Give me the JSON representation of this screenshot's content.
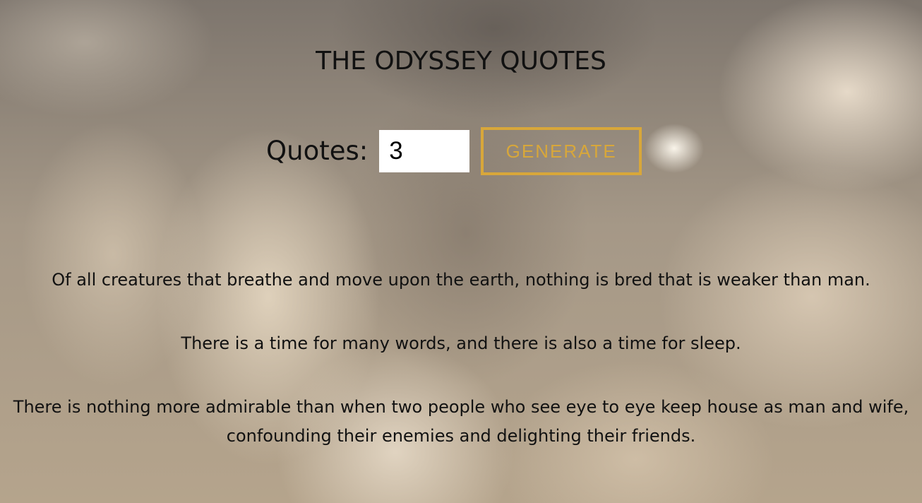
{
  "page": {
    "title": "THE ODYSSEY QUOTES"
  },
  "controls": {
    "quotes_label": "Quotes:",
    "quote_count": "3",
    "generate_label": "GENERATE",
    "accent_color": "#d8a73a"
  },
  "quotes": [
    {
      "text": "Of all creatures that breathe and move upon the earth, nothing is bred that is weaker than man."
    },
    {
      "text": "There is a time for many words, and there is also a time for sleep."
    },
    {
      "text": "There is nothing more admirable than when two people who see eye to eye keep house as man and wife, confounding their enemies and delighting their friends."
    }
  ]
}
